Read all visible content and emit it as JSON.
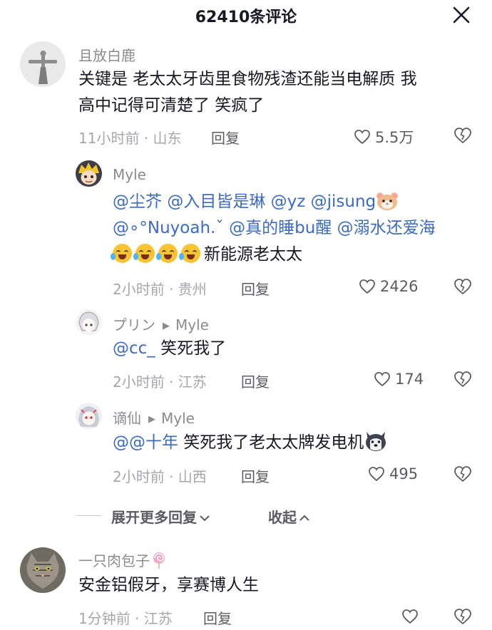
{
  "header": {
    "title": "62410条评论"
  },
  "comments": [
    {
      "username": "且放白鹿",
      "lines": [
        "关键是 老太太牙齿里食物残渣还能当电解质 我",
        "高中记得可清楚了 笑疯了"
      ],
      "meta": "11小时前 · 山东",
      "reply_label": "回复",
      "likes": "5.5万"
    },
    {
      "username": "一只肉包子",
      "text": "安金铝假牙，享赛博人生",
      "meta": "1分钟前 · 江苏",
      "reply_label": "回复"
    }
  ],
  "replies": [
    {
      "username": "Myle",
      "line1_mentions": [
        "@尘芥",
        "@入目皆是琳",
        "@yz",
        "@jisung"
      ],
      "line2_mentions": [
        "@∘°Nuyoah.ˇ",
        "@真的睡bu醒",
        "@溺水还爱海"
      ],
      "line3_text": "新能源老太太",
      "meta": "2小时前 · 贵州",
      "reply_label": "回复",
      "likes": "2426"
    },
    {
      "username": "プリン",
      "reply_to": "Myle",
      "mention": "@cc_",
      "text": " 笑死我了",
      "meta": "2小时前 · 江苏",
      "reply_label": "回复",
      "likes": "174"
    },
    {
      "username": "谪仙",
      "reply_to": "Myle",
      "mention": "@@十年",
      "text": " 笑死我了老太太牌发电机",
      "meta": "2小时前 · 山西",
      "reply_label": "回复",
      "likes": "495"
    }
  ],
  "thread_controls": {
    "expand_label": "展开更多回复",
    "collapse_label": "收起"
  },
  "icons": [
    "close-icon",
    "heart-icon",
    "broken-heart-icon",
    "chevron-down-icon",
    "chevron-up-icon",
    "crying-laughing-emoji",
    "hamster-emoji",
    "husky-emoji",
    "lollipop-emoji"
  ],
  "colors": {
    "mention": "#3b6bc5",
    "text": "#161823",
    "secondary": "#8a8b91"
  }
}
